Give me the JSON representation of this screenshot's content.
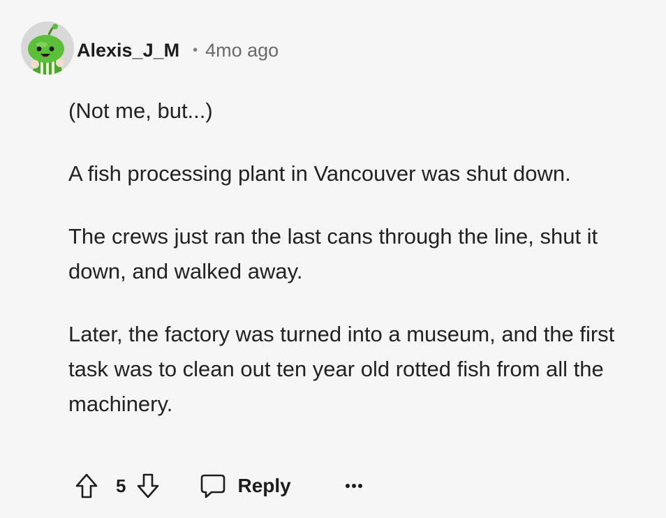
{
  "comment": {
    "author": "Alexis_J_M",
    "separator": "•",
    "time": "4mo ago",
    "paragraphs": [
      "(Not me, but...)",
      "A fish processing plant in Vancouver was shut down.",
      "The crews just ran the last cans through the line, shut it down, and walked away.",
      "Later, the factory was turned into a museum, and the first task was to clean out ten year old rotted fish from all the machinery."
    ]
  },
  "actions": {
    "score": "5",
    "reply_label": "Reply",
    "upvote_icon": "arrow-up-outline",
    "downvote_icon": "arrow-down-outline",
    "reply_icon": "speech-bubble",
    "more_icon": "ellipsis"
  },
  "colors": {
    "background": "#f6f6f6",
    "text": "#1c1c1c",
    "muted": "#6a6a6a",
    "avatar_green": "#5cbf3a"
  }
}
